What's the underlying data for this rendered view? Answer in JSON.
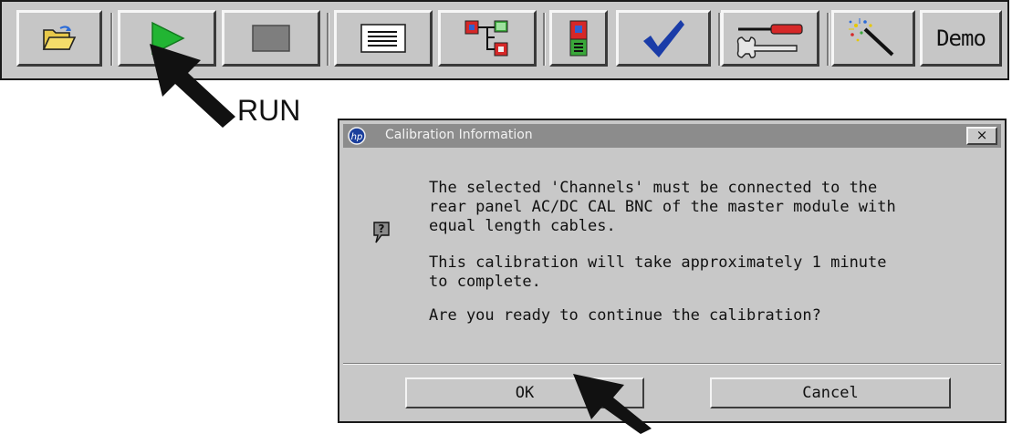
{
  "toolbar": {
    "buttons": [
      {
        "name": "open-folder",
        "icon": "folder-open-icon"
      },
      {
        "name": "run",
        "icon": "play-icon",
        "color": "#22b533"
      },
      {
        "name": "stop",
        "icon": "stop-icon"
      },
      {
        "name": "listing",
        "icon": "listing-icon"
      },
      {
        "name": "setup",
        "icon": "module-tree-icon"
      },
      {
        "name": "module",
        "icon": "module-icon"
      },
      {
        "name": "calibration",
        "icon": "checkmark-icon",
        "color": "#1a3ca8"
      },
      {
        "name": "tools",
        "icon": "tools-icon"
      },
      {
        "name": "wizard",
        "icon": "magic-wand-icon"
      },
      {
        "name": "demo",
        "label": "Demo"
      }
    ]
  },
  "annotation": {
    "run_label": "RUN"
  },
  "dialog": {
    "title": "Calibration Information",
    "close_label": "×",
    "paragraph1": "The selected 'Channels' must be connected to the\nrear panel AC/DC CAL BNC of the master module with\nequal length cables.",
    "paragraph2": "This calibration will take approximately 1 minute\nto complete.",
    "paragraph3": "Are you ready to continue the calibration?",
    "ok_label": "OK",
    "cancel_label": "Cancel"
  }
}
